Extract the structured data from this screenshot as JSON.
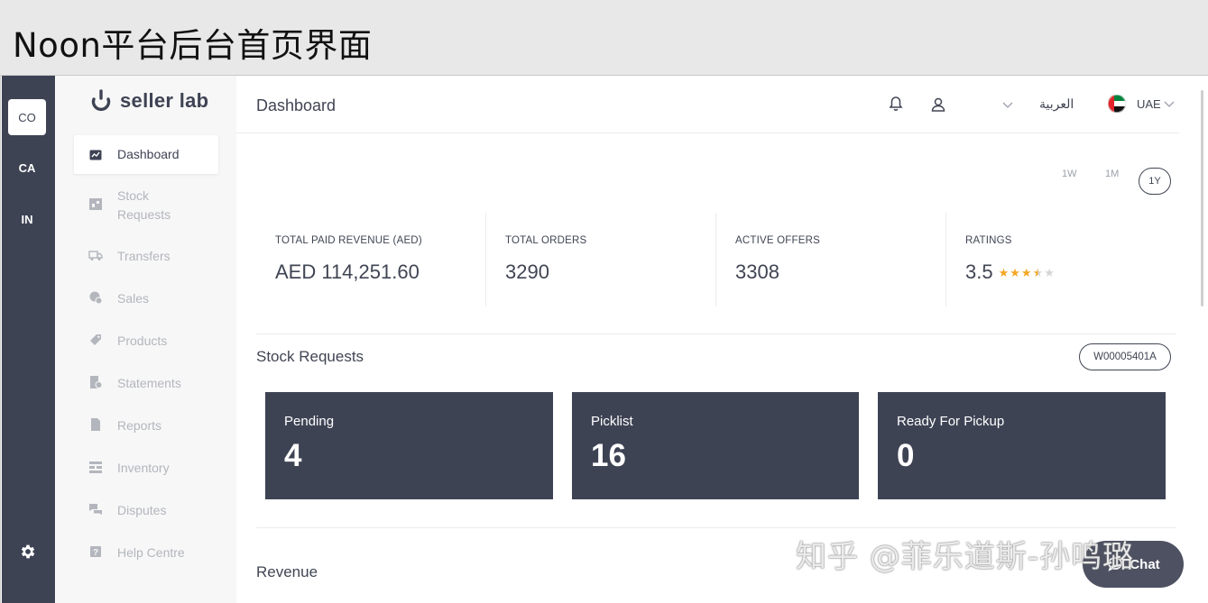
{
  "banner": {
    "title": "Noon平台后台首页界面"
  },
  "rail": {
    "items": [
      "CO",
      "CA",
      "IN"
    ],
    "settings_icon": "gear-icon"
  },
  "logo": {
    "text": "seller lab"
  },
  "sidebar": {
    "items": [
      {
        "label": "Dashboard",
        "icon": "chart-icon",
        "active": true
      },
      {
        "label": "Stock Requests",
        "icon": "warehouse-icon",
        "active": false
      },
      {
        "label": "Transfers",
        "icon": "truck-icon",
        "active": false
      },
      {
        "label": "Sales",
        "icon": "coins-icon",
        "active": false
      },
      {
        "label": "Products",
        "icon": "tag-icon",
        "active": false
      },
      {
        "label": "Statements",
        "icon": "statement-icon",
        "active": false
      },
      {
        "label": "Reports",
        "icon": "file-icon",
        "active": false
      },
      {
        "label": "Inventory",
        "icon": "barcode-icon",
        "active": false
      },
      {
        "label": "Disputes",
        "icon": "chat-bubbles-icon",
        "active": false
      },
      {
        "label": "Help Centre",
        "icon": "help-icon",
        "active": false
      }
    ]
  },
  "header": {
    "title": "Dashboard",
    "language": "العربية",
    "country": "UAE",
    "icons": [
      "bell-icon",
      "user-icon",
      "chevron-down-icon",
      "uae-flag-icon"
    ]
  },
  "range": {
    "options": [
      "1W",
      "1M",
      "1Y"
    ],
    "selected": "1Y"
  },
  "stats": [
    {
      "label": "TOTAL PAID REVENUE (AED)",
      "value": "AED 114,251.60"
    },
    {
      "label": "TOTAL ORDERS",
      "value": "3290"
    },
    {
      "label": "ACTIVE OFFERS",
      "value": "3308"
    },
    {
      "label": "RATINGS",
      "value": "3.5",
      "rating": 3.5,
      "max": 5
    }
  ],
  "stock_requests": {
    "title": "Stock Requests",
    "warehouse_code": "W00005401A",
    "cards": [
      {
        "label": "Pending",
        "count": "4"
      },
      {
        "label": "Picklist",
        "count": "16"
      },
      {
        "label": "Ready For Pickup",
        "count": "0"
      }
    ]
  },
  "revenue": {
    "title": "Revenue"
  },
  "chat": {
    "label": "Chat"
  },
  "watermark": {
    "text": "知乎 @菲乐道斯-孙鸣璐"
  },
  "colors": {
    "dark": "#3e4354",
    "star": "#f5a623",
    "star_empty": "#d5d5d5",
    "sidebar_bg": "#f7f7f7"
  }
}
